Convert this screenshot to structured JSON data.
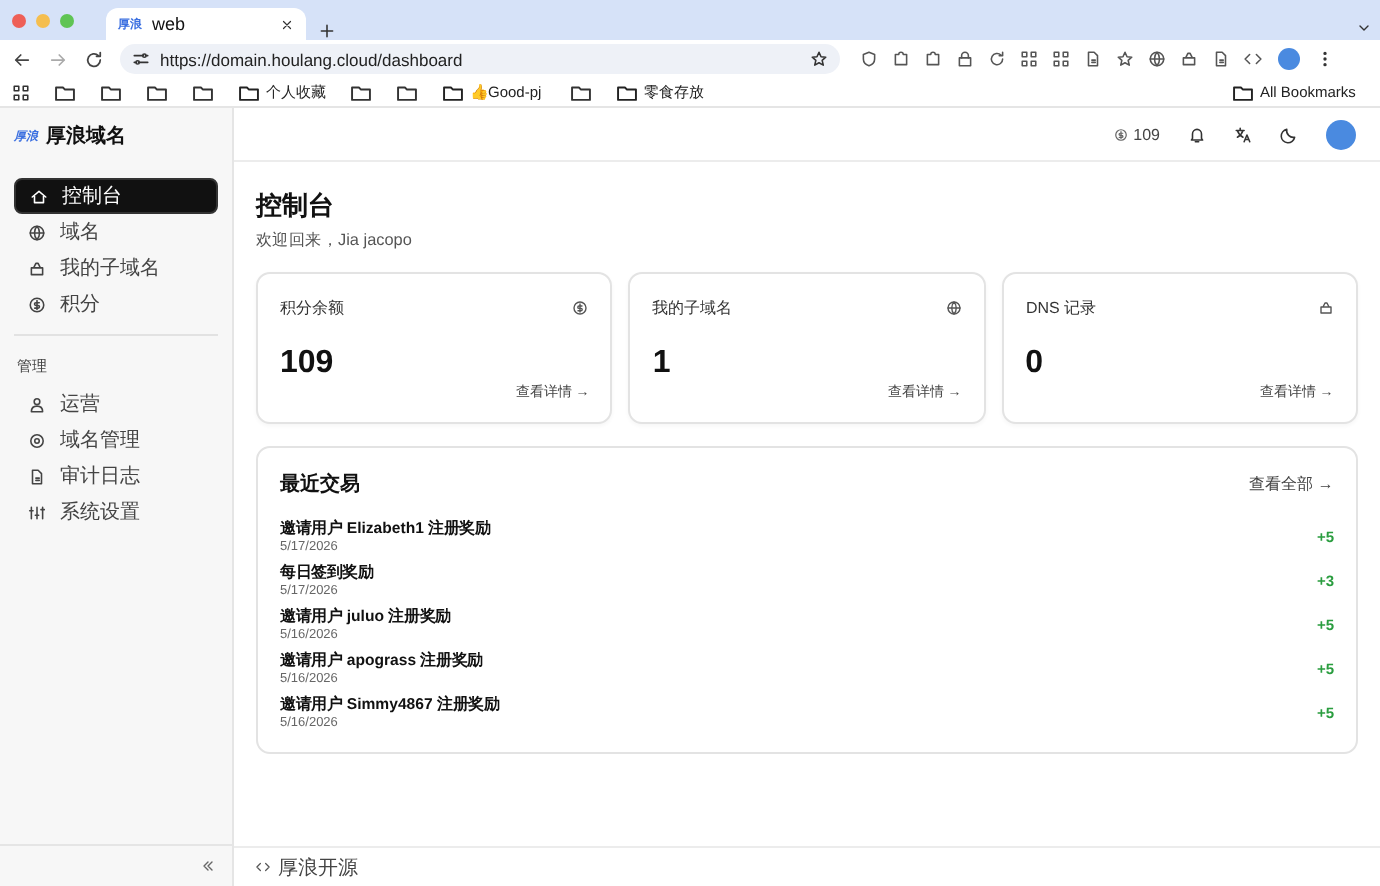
{
  "browser": {
    "tab": {
      "favicon": "厚浪",
      "title": "web"
    },
    "url": "https://domain.houlang.cloud/dashboard",
    "bookmarks": [
      {
        "kind": "icon"
      },
      {
        "kind": "icon"
      },
      {
        "kind": "icon"
      },
      {
        "kind": "icon"
      },
      {
        "kind": "labeled",
        "label": "个人收藏"
      },
      {
        "kind": "icon"
      },
      {
        "kind": "icon"
      },
      {
        "kind": "labeled",
        "label": "👍Good-pj"
      },
      {
        "kind": "icon"
      },
      {
        "kind": "labeled",
        "label": "零食存放"
      }
    ],
    "all_bookmarks": "All Bookmarks"
  },
  "brand": {
    "logo": "厚浪",
    "name": "厚浪域名"
  },
  "header": {
    "points": "109"
  },
  "sidebar": {
    "groups": [
      {
        "items": [
          {
            "label": "控制台",
            "selected": true
          },
          {
            "label": "域名",
            "selected": false
          },
          {
            "label": "我的子域名",
            "selected": false
          },
          {
            "label": "积分",
            "selected": false
          }
        ]
      },
      {
        "title": "管理",
        "items": [
          {
            "label": "运营",
            "selected": false
          },
          {
            "label": "域名管理",
            "selected": false
          },
          {
            "label": "审计日志",
            "selected": false
          },
          {
            "label": "系统设置",
            "selected": false
          }
        ]
      }
    ]
  },
  "page": {
    "title": "控制台",
    "subtitle": "欢迎回来，Jia jacopo"
  },
  "stats": [
    {
      "label": "积分余额",
      "value": "109",
      "link": "查看详情 →"
    },
    {
      "label": "我的子域名",
      "value": "1",
      "link": "查看详情 →"
    },
    {
      "label": "DNS 记录",
      "value": "0",
      "link": "查看详情 →"
    }
  ],
  "transactions": {
    "title": "最近交易",
    "link": "查看全部 →",
    "items": [
      {
        "title": "邀请用户 Elizabeth1 注册奖励",
        "date": "5/17/2026",
        "amount": "+5"
      },
      {
        "title": "每日签到奖励",
        "date": "5/17/2026",
        "amount": "+3"
      },
      {
        "title": "邀请用户 juluo 注册奖励",
        "date": "5/16/2026",
        "amount": "+5"
      },
      {
        "title": "邀请用户 apograss 注册奖励",
        "date": "5/16/2026",
        "amount": "+5"
      },
      {
        "title": "邀请用户 Simmy4867 注册奖励",
        "date": "5/16/2026",
        "amount": "+5"
      }
    ]
  },
  "footer": {
    "label": "厚浪开源"
  }
}
